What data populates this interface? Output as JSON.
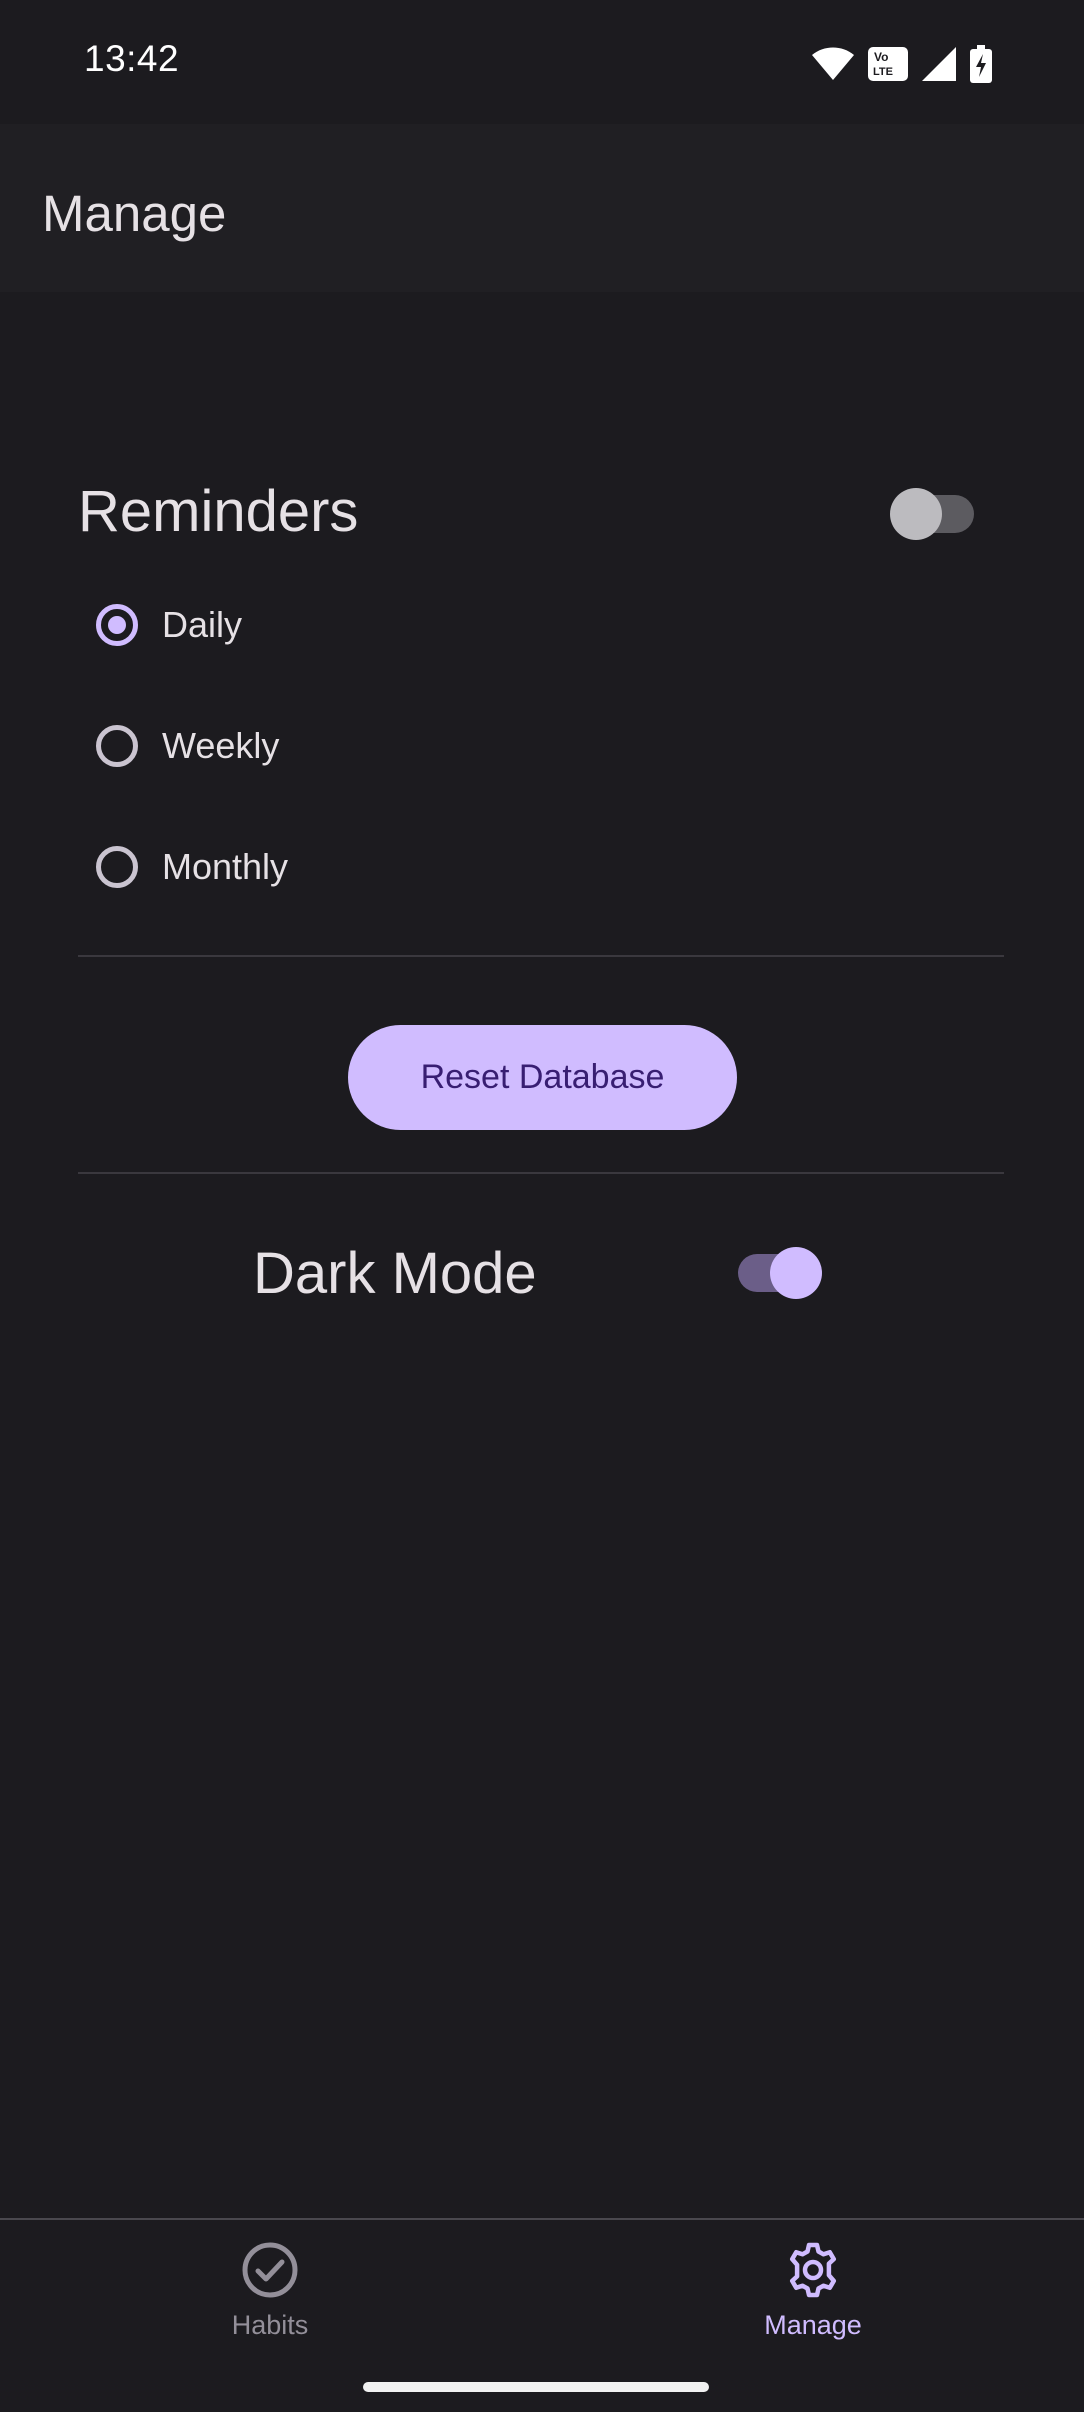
{
  "status_bar": {
    "time": "13:42",
    "icons": [
      "wifi-icon",
      "volte-icon",
      "signal-icon",
      "battery-charging-icon"
    ],
    "volte_line1": "Vo",
    "volte_line2": "LTE"
  },
  "app_bar": {
    "title": "Manage"
  },
  "reminders": {
    "title": "Reminders",
    "enabled": false,
    "options": [
      {
        "label": "Daily",
        "selected": true
      },
      {
        "label": "Weekly",
        "selected": false
      },
      {
        "label": "Monthly",
        "selected": false
      }
    ]
  },
  "reset_button": {
    "label": "Reset Database"
  },
  "dark_mode": {
    "label": "Dark Mode",
    "enabled": true
  },
  "bottom_nav": {
    "items": [
      {
        "label": "Habits",
        "icon": "check-circle-icon",
        "active": false
      },
      {
        "label": "Manage",
        "icon": "gear-icon",
        "active": true
      }
    ]
  },
  "colors": {
    "background": "#1c1b1f",
    "app_bar": "#201f23",
    "accent": "#d0bcff",
    "on_accent": "#381e72",
    "text": "#e6e1e5",
    "inactive_nav": "#938f99"
  }
}
